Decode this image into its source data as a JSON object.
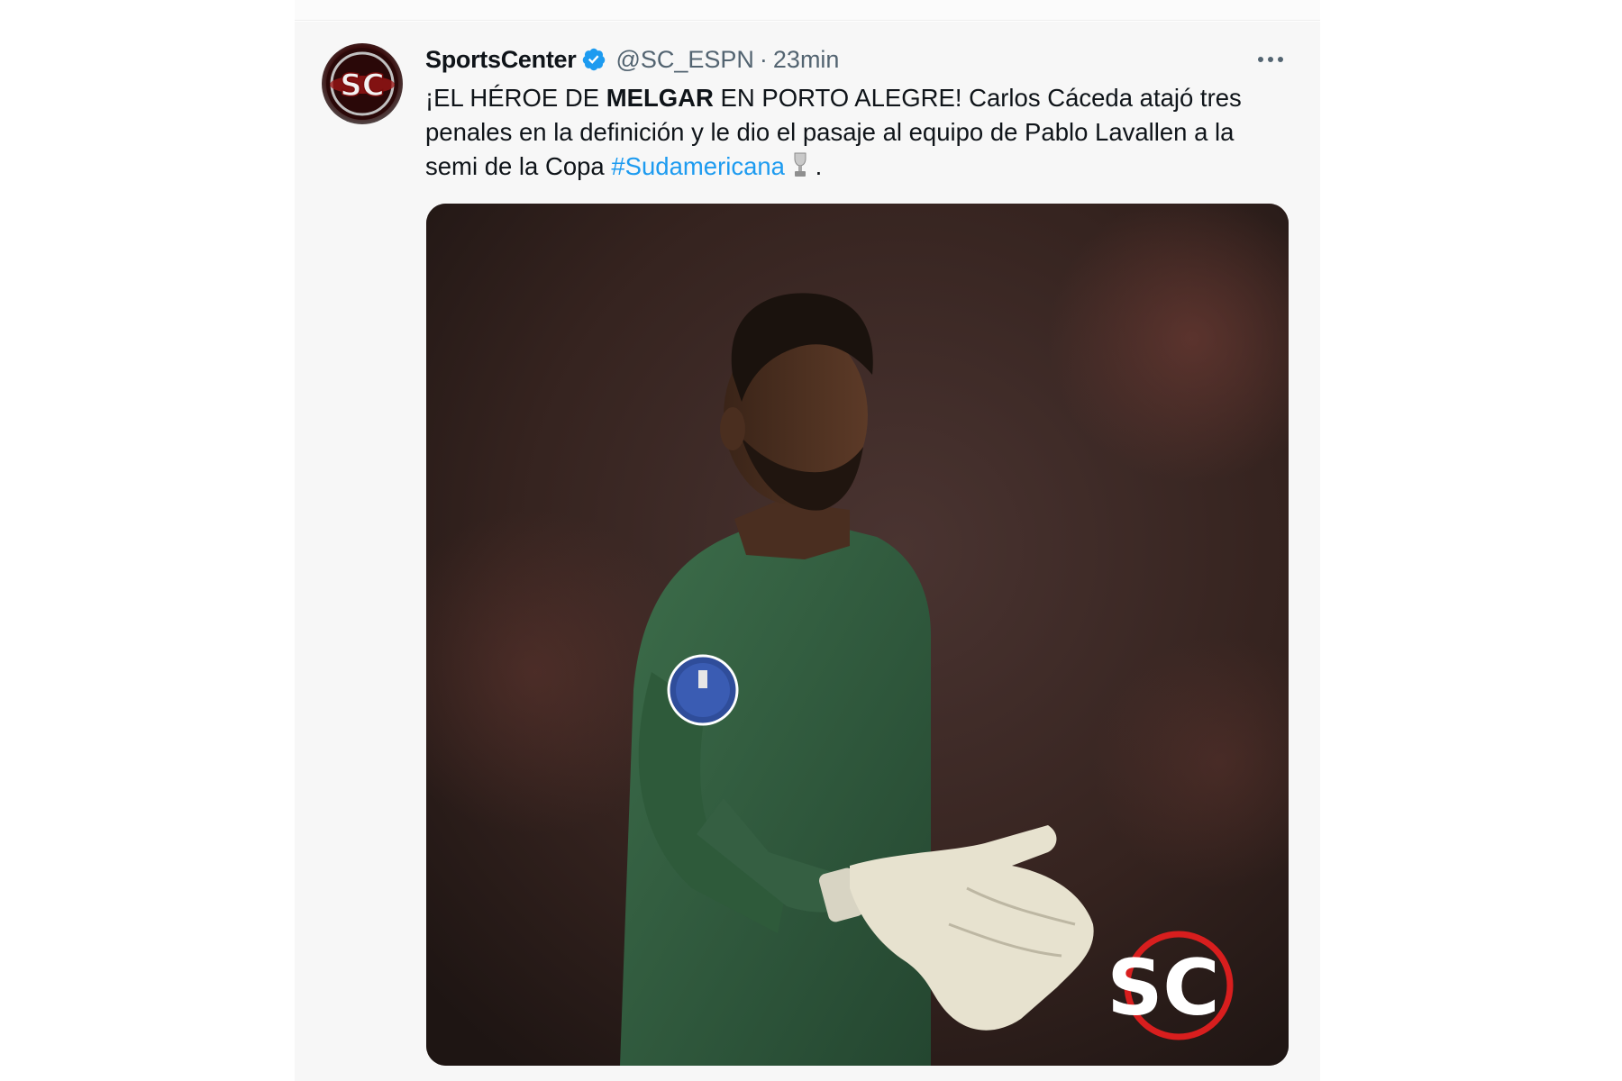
{
  "tweet": {
    "author": {
      "name": "SportsCenter",
      "handle": "@SC_ESPN",
      "avatar_icon": "sportscenter-logo-icon",
      "verified_icon": "verified-badge-icon"
    },
    "separator": "·",
    "time": "23min",
    "more_icon": "more-options-icon",
    "text": {
      "line1_pre": "¡EL HÉROE DE ",
      "line1_bold": "MELGAR",
      "line1_post": " EN PORTO ALEGRE! Carlos Cáceda atajó tres",
      "line2": "penales en la definición y le dio el pasaje al equipo de Pablo Lavallen a la",
      "line3_pre": "semi de la Copa ",
      "hashtag": "#Sudamericana",
      "trophy_icon": "trophy-icon",
      "line3_post": " ."
    },
    "media": {
      "image": "goalkeeper-photo",
      "watermark_text": "SC"
    }
  },
  "colors": {
    "text": "#0f1419",
    "secondary_text": "#536471",
    "link": "#1d9bf0",
    "verified": "#1d9bf0",
    "card_background": "#f7f7f7",
    "jersey": "#2f5a3c",
    "watermark_ring": "#d81e1e"
  }
}
